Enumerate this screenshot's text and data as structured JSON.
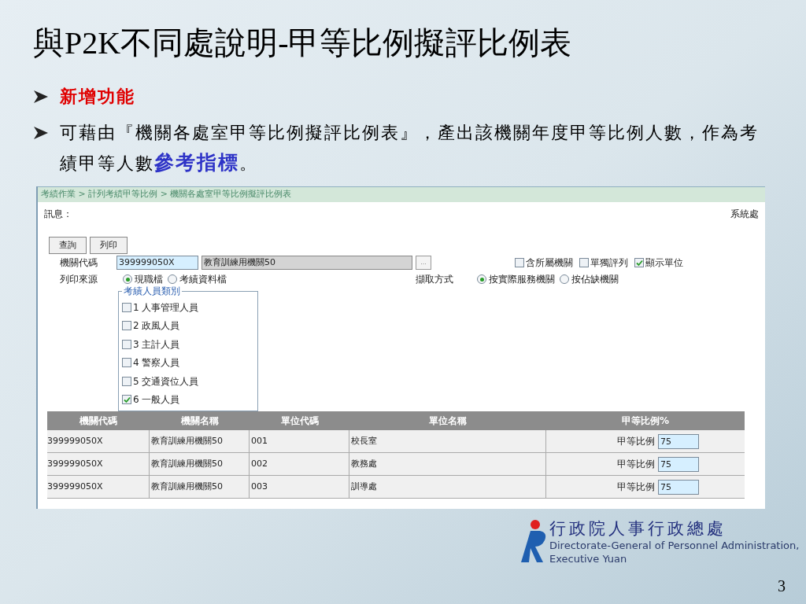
{
  "slide": {
    "title": "與P2K不同處說明-甲等比例擬評比例表",
    "bullets": [
      {
        "text": "新增功能",
        "kind": "heading"
      },
      {
        "text": "可藉由『機關各處室甲等比例擬評比例表』，產出該機關年度甲等比例人數，作為考績甲等人數**參考指標**。",
        "kind": "body"
      }
    ],
    "page_number": "3"
  },
  "screen": {
    "breadcrumb": "考績作業 > 計列考績甲等比例 > 機關各處室甲等比例擬評比例表",
    "message_label": "訊息：",
    "system_text": "系統處",
    "buttons": [
      "查詢",
      "列印"
    ],
    "agency_code": {
      "label": "機關代碼",
      "value": "399999050X",
      "name": "教育訓練用機關50",
      "browse": "..."
    },
    "options": [
      {
        "label": "含所屬機關",
        "checked": false
      },
      {
        "label": "單獨評列",
        "checked": false
      },
      {
        "label": "顯示單位",
        "checked": true
      }
    ],
    "print_source": {
      "label": "列印來源",
      "choices": [
        {
          "label": "現職檔",
          "selected": true
        },
        {
          "label": "考績資料檔",
          "selected": false
        }
      ]
    },
    "fetch_method": {
      "label": "擷取方式",
      "choices": [
        {
          "label": "按實際服務機關",
          "selected": true
        },
        {
          "label": "按佔缺機關",
          "selected": false
        }
      ]
    },
    "staff_types": {
      "legend": "考績人員類別",
      "items": [
        {
          "label": "1 人事管理人員",
          "checked": false
        },
        {
          "label": "2 政風人員",
          "checked": false
        },
        {
          "label": "3 主計人員",
          "checked": false
        },
        {
          "label": "4 警察人員",
          "checked": false
        },
        {
          "label": "5 交通資位人員",
          "checked": false
        },
        {
          "label": "6 一般人員",
          "checked": true
        }
      ]
    },
    "table": {
      "columns": [
        "機關代碼",
        "機關名稱",
        "單位代碼",
        "單位名稱",
        "甲等比例%"
      ],
      "rows": [
        {
          "agency_code": "399999050X",
          "agency_name": "教育訓練用機關50",
          "unit_code": "001",
          "unit_name": "校長室",
          "ratio_label": "甲等比例",
          "ratio": "75"
        },
        {
          "agency_code": "399999050X",
          "agency_name": "教育訓練用機關50",
          "unit_code": "002",
          "unit_name": "教務處",
          "ratio_label": "甲等比例",
          "ratio": "75"
        },
        {
          "agency_code": "399999050X",
          "agency_name": "教育訓練用機關50",
          "unit_code": "003",
          "unit_name": "訓導處",
          "ratio_label": "甲等比例",
          "ratio": "75"
        }
      ]
    }
  },
  "logo": {
    "name_zh": "行政院人事行政總處",
    "name_en_1": "Directorate-General of Personnel Administration,",
    "name_en_2": "Executive Yuan"
  }
}
